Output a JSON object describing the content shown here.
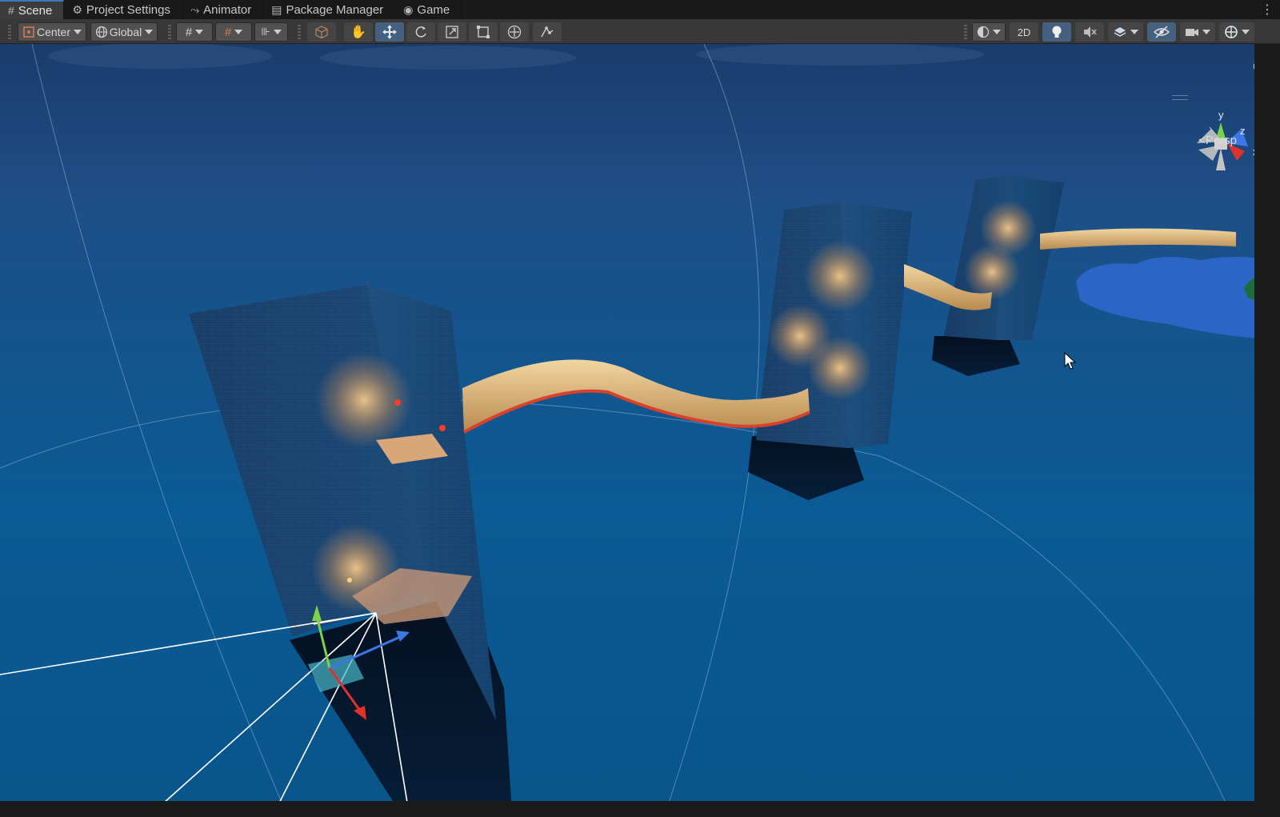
{
  "tabs": [
    {
      "label": "Scene",
      "icon": "hash-icon",
      "active": true
    },
    {
      "label": "Project Settings",
      "icon": "gear-icon",
      "active": false
    },
    {
      "label": "Animator",
      "icon": "animator-icon",
      "active": false
    },
    {
      "label": "Package Manager",
      "icon": "package-icon",
      "active": false
    },
    {
      "label": "Game",
      "icon": "gamepad-icon",
      "active": false
    }
  ],
  "toolbar": {
    "pivot_mode": "Center",
    "pivot_rotation": "Global",
    "mode_2d": "2D"
  },
  "viewport": {
    "projection_label": "Persp",
    "gizmo_axes": {
      "y": "y",
      "z": "z",
      "x": "x"
    },
    "sky_color": "#1e4f86"
  },
  "colors": {
    "accent": "#3a79bb",
    "toolbar_bg": "#383838",
    "active_toggle": "#46607f",
    "axis_x": "#e0312b",
    "axis_y": "#7cd34a",
    "axis_z": "#3b78e6"
  }
}
